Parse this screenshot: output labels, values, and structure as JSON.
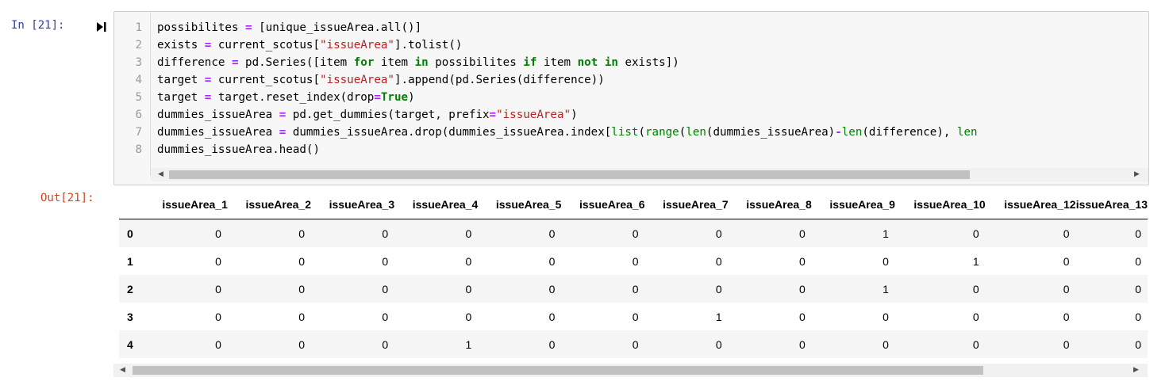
{
  "input_prompt": "In [21]:",
  "output_prompt": "Out[21]:",
  "code": {
    "line_numbers": [
      "1",
      "2",
      "3",
      "4",
      "5",
      "6",
      "7",
      "8"
    ],
    "lines": [
      [
        {
          "t": "possibilites "
        },
        {
          "t": "=",
          "c": "op"
        },
        {
          "t": " [unique_issueArea.all()]"
        }
      ],
      [
        {
          "t": "exists "
        },
        {
          "t": "=",
          "c": "op"
        },
        {
          "t": " current_scotus["
        },
        {
          "t": "\"issueArea\"",
          "c": "str"
        },
        {
          "t": "].tolist()"
        }
      ],
      [
        {
          "t": "difference "
        },
        {
          "t": "=",
          "c": "op"
        },
        {
          "t": " pd.Series([item "
        },
        {
          "t": "for",
          "c": "kw"
        },
        {
          "t": " item "
        },
        {
          "t": "in",
          "c": "kw"
        },
        {
          "t": " possibilites "
        },
        {
          "t": "if",
          "c": "kw"
        },
        {
          "t": " item "
        },
        {
          "t": "not",
          "c": "kw"
        },
        {
          "t": " "
        },
        {
          "t": "in",
          "c": "kw"
        },
        {
          "t": " exists])"
        }
      ],
      [
        {
          "t": "target "
        },
        {
          "t": "=",
          "c": "op"
        },
        {
          "t": " current_scotus["
        },
        {
          "t": "\"issueArea\"",
          "c": "str"
        },
        {
          "t": "].append(pd.Series(difference))"
        }
      ],
      [
        {
          "t": "target "
        },
        {
          "t": "=",
          "c": "op"
        },
        {
          "t": " target.reset_index(drop"
        },
        {
          "t": "=",
          "c": "op"
        },
        {
          "t": "True",
          "c": "kw"
        },
        {
          "t": ")"
        }
      ],
      [
        {
          "t": "dummies_issueArea "
        },
        {
          "t": "=",
          "c": "op"
        },
        {
          "t": " pd.get_dummies(target, prefix"
        },
        {
          "t": "=",
          "c": "op"
        },
        {
          "t": "\"issueArea\"",
          "c": "str"
        },
        {
          "t": ")"
        }
      ],
      [
        {
          "t": "dummies_issueArea "
        },
        {
          "t": "=",
          "c": "op"
        },
        {
          "t": " dummies_issueArea.drop(dummies_issueArea.index["
        },
        {
          "t": "list",
          "c": "bi"
        },
        {
          "t": "("
        },
        {
          "t": "range",
          "c": "bi"
        },
        {
          "t": "("
        },
        {
          "t": "len",
          "c": "bi"
        },
        {
          "t": "(dummies_issueArea)"
        },
        {
          "t": "-",
          "c": "op"
        },
        {
          "t": "len",
          "c": "bi"
        },
        {
          "t": "(difference), "
        },
        {
          "t": "len",
          "c": "bi"
        }
      ],
      [
        {
          "t": "dummies_issueArea.head()"
        }
      ]
    ]
  },
  "colors": {
    "keyword": "#008000",
    "operator": "#aa22ff",
    "string": "#ba2121",
    "in_prompt": "#303f9f",
    "out_prompt": "#d84315"
  },
  "icons": {
    "run": "step-forward-icon",
    "scroll_left": "triangle-left-icon",
    "scroll_right": "triangle-right-icon"
  },
  "table": {
    "columns": [
      "issueArea_1",
      "issueArea_2",
      "issueArea_3",
      "issueArea_4",
      "issueArea_5",
      "issueArea_6",
      "issueArea_7",
      "issueArea_8",
      "issueArea_9",
      "issueArea_10",
      "issueArea_12",
      "issueArea_13"
    ],
    "rows": [
      {
        "index": "0",
        "values": [
          "0",
          "0",
          "0",
          "0",
          "0",
          "0",
          "0",
          "0",
          "1",
          "0",
          "0",
          "0"
        ]
      },
      {
        "index": "1",
        "values": [
          "0",
          "0",
          "0",
          "0",
          "0",
          "0",
          "0",
          "0",
          "0",
          "1",
          "0",
          "0"
        ]
      },
      {
        "index": "2",
        "values": [
          "0",
          "0",
          "0",
          "0",
          "0",
          "0",
          "0",
          "0",
          "1",
          "0",
          "0",
          "0"
        ]
      },
      {
        "index": "3",
        "values": [
          "0",
          "0",
          "0",
          "0",
          "0",
          "0",
          "1",
          "0",
          "0",
          "0",
          "0",
          "0"
        ]
      },
      {
        "index": "4",
        "values": [
          "0",
          "0",
          "0",
          "1",
          "0",
          "0",
          "0",
          "0",
          "0",
          "0",
          "0",
          "0"
        ]
      }
    ]
  }
}
